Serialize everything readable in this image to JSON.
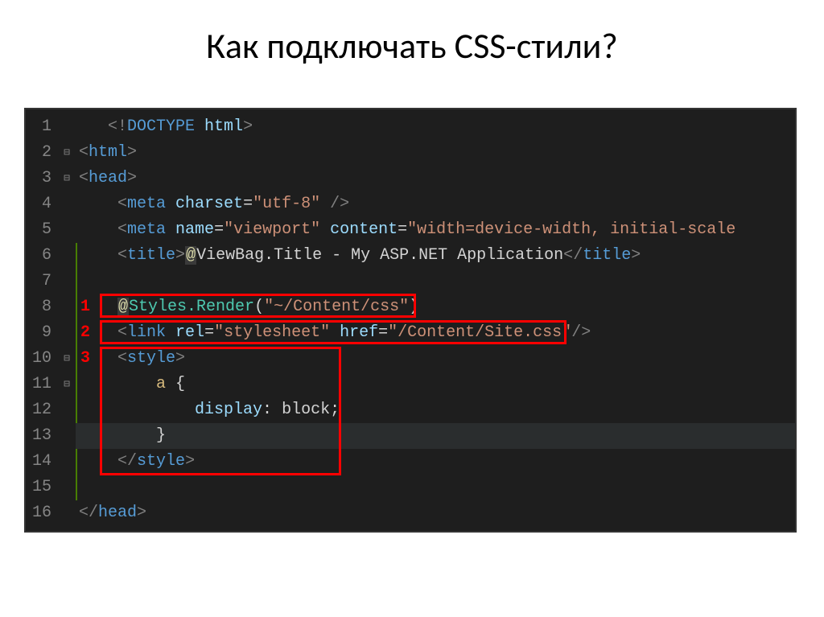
{
  "title": "Как подключать CSS-стили?",
  "annotations": {
    "n1": "1",
    "n2": "2",
    "n3": "3"
  },
  "lines": {
    "l1": {
      "num": "1"
    },
    "l2": {
      "num": "2"
    },
    "l3": {
      "num": "3"
    },
    "l4": {
      "num": "4"
    },
    "l5": {
      "num": "5"
    },
    "l6": {
      "num": "6"
    },
    "l7": {
      "num": "7"
    },
    "l8": {
      "num": "8"
    },
    "l9": {
      "num": "9"
    },
    "l10": {
      "num": "10"
    },
    "l11": {
      "num": "11"
    },
    "l12": {
      "num": "12"
    },
    "l13": {
      "num": "13"
    },
    "l14": {
      "num": "14"
    },
    "l15": {
      "num": "15"
    },
    "l16": {
      "num": "16"
    }
  },
  "code": {
    "doctype_open": "<!",
    "doctype_kw": "DOCTYPE",
    "doctype_html": " html",
    "close_punc": ">",
    "open_punc": "<",
    "slash_punc": "/",
    "html_tag": "html",
    "head_tag": "head",
    "meta_tag": "meta",
    "charset_attr": " charset",
    "eq": "=",
    "utf8_val": "\"utf-8\"",
    "slash_close": " />",
    "name_attr": " name",
    "viewport_val": "\"viewport\"",
    "content_attr": " content",
    "content_val": "\"width=device-width, initial-scale",
    "title_tag": "title",
    "at": "@",
    "viewbag": "ViewBag.Title",
    "title_text": " - My ASP.NET Application",
    "styles_render": "Styles.Render",
    "paren_open": "(",
    "paren_close": ")",
    "css_path": "\"~/Content/css\"",
    "link_tag": "link",
    "rel_attr": " rel",
    "stylesheet_val": "\"stylesheet\"",
    "href_attr": " href",
    "site_css_val": "\"/Content/Site.css\"",
    "slash_gt": "/>",
    "style_tag": "style",
    "a_sel": "a",
    "brace_open": " {",
    "display_prop": "display",
    "colon": ":",
    "block_val": " block",
    "semi": ";",
    "brace_close": "}"
  }
}
